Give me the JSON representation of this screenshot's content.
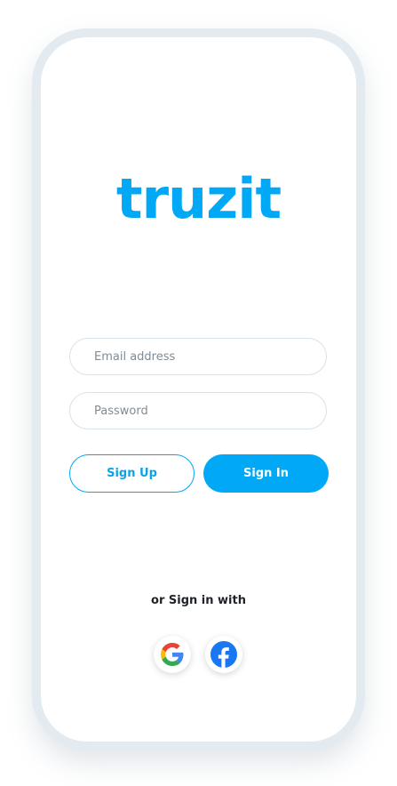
{
  "brand": {
    "logo_text": "truzit",
    "accent_color": "#00a8f5"
  },
  "form": {
    "email_placeholder": "Email address",
    "password_placeholder": "Password",
    "signup_label": "Sign Up",
    "signin_label": "Sign In"
  },
  "social": {
    "prompt": "or Sign in with",
    "providers": [
      {
        "name": "google",
        "icon": "google-icon"
      },
      {
        "name": "facebook",
        "icon": "facebook-icon"
      }
    ]
  }
}
